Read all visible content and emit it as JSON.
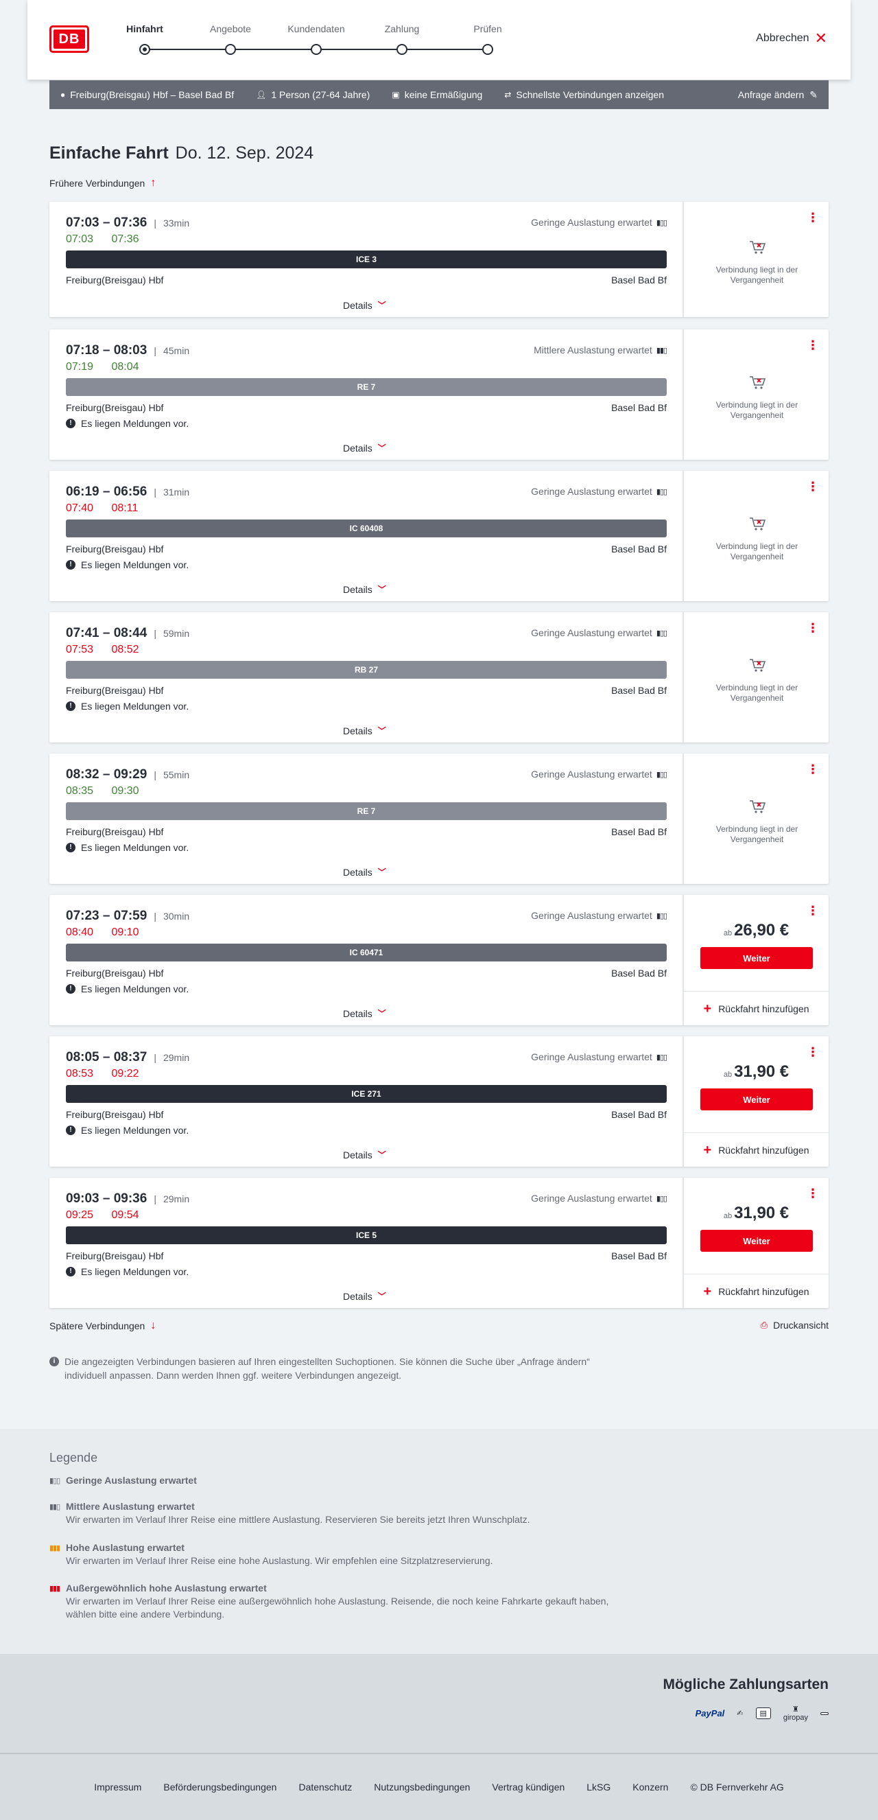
{
  "header": {
    "logo_text": "DB",
    "steps": [
      "Hinfahrt",
      "Angebote",
      "Kundendaten",
      "Zahlung",
      "Prüfen"
    ],
    "cancel_label": "Abbrechen"
  },
  "search": {
    "route": "Freiburg(Breisgau) Hbf – Basel Bad Bf",
    "passengers": "1 Person (27-64 Jahre)",
    "discount": "keine Ermäßigung",
    "fastest": "Schnellste Verbindungen anzeigen",
    "change_label": "Anfrage ändern"
  },
  "page": {
    "title_bold": "Einfache Fahrt",
    "title_date": "Do. 12. Sep. 2024",
    "earlier_label": "Frühere Verbindungen",
    "later_label": "Spätere Verbindungen",
    "print_label": "Druckansicht",
    "info_text": "Die angezeigten Verbindungen basieren auf Ihren eingestellten Suchoptionen. Sie können die Suche über „Anfrage ändern“ individuell anpassen. Dann werden Ihnen ggf. weitere Verbindungen angezeigt."
  },
  "connections": [
    {
      "times": "07:03 – 07:36",
      "duration": "33min",
      "load": "Geringe Auslastung erwartet",
      "rt_dep": "07:03",
      "rt_arr": "07:36",
      "rt_status": "ontime",
      "train": "ICE 3",
      "bar": "dark",
      "from": "Freiburg(Breisgau) Hbf",
      "to": "Basel Bad Bf",
      "note": "",
      "details": "Details",
      "past_text": "Verbindung liegt in der Vergangenheit",
      "price_prefix": "",
      "price": "",
      "button": "",
      "return_label": ""
    },
    {
      "times": "07:18 – 08:03",
      "duration": "45min",
      "load": "Mittlere Auslastung erwartet",
      "rt_dep": "07:19",
      "rt_arr": "08:04",
      "rt_status": "ontime",
      "train": "RE 7",
      "bar": "light",
      "from": "Freiburg(Breisgau) Hbf",
      "to": "Basel Bad Bf",
      "note": "Es liegen Meldungen vor.",
      "details": "Details",
      "past_text": "Verbindung liegt in der Vergangenheit",
      "price_prefix": "",
      "price": "",
      "button": "",
      "return_label": ""
    },
    {
      "times": "06:19 – 06:56",
      "duration": "31min",
      "load": "Geringe Auslastung erwartet",
      "rt_dep": "07:40",
      "rt_arr": "08:11",
      "rt_status": "late",
      "train": "IC 60408",
      "bar": "mid",
      "from": "Freiburg(Breisgau) Hbf",
      "to": "Basel Bad Bf",
      "note": "Es liegen Meldungen vor.",
      "details": "Details",
      "past_text": "Verbindung liegt in der Vergangenheit",
      "price_prefix": "",
      "price": "",
      "button": "",
      "return_label": ""
    },
    {
      "times": "07:41 – 08:44",
      "duration": "59min",
      "load": "Geringe Auslastung erwartet",
      "rt_dep": "07:53",
      "rt_arr": "08:52",
      "rt_status": "late",
      "train": "RB 27",
      "bar": "light",
      "from": "Freiburg(Breisgau) Hbf",
      "to": "Basel Bad Bf",
      "note": "Es liegen Meldungen vor.",
      "details": "Details",
      "past_text": "Verbindung liegt in der Vergangenheit",
      "price_prefix": "",
      "price": "",
      "button": "",
      "return_label": ""
    },
    {
      "times": "08:32 – 09:29",
      "duration": "55min",
      "load": "Geringe Auslastung erwartet",
      "rt_dep": "08:35",
      "rt_arr": "09:30",
      "rt_status": "ontime",
      "train": "RE 7",
      "bar": "light",
      "from": "Freiburg(Breisgau) Hbf",
      "to": "Basel Bad Bf",
      "note": "Es liegen Meldungen vor.",
      "details": "Details",
      "past_text": "Verbindung liegt in der Vergangenheit",
      "price_prefix": "",
      "price": "",
      "button": "",
      "return_label": ""
    },
    {
      "times": "07:23 – 07:59",
      "duration": "30min",
      "load": "Geringe Auslastung erwartet",
      "rt_dep": "08:40",
      "rt_arr": "09:10",
      "rt_status": "late",
      "train": "IC 60471",
      "bar": "mid",
      "from": "Freiburg(Breisgau) Hbf",
      "to": "Basel Bad Bf",
      "note": "Es liegen Meldungen vor.",
      "details": "Details",
      "past_text": "",
      "price_prefix": "ab",
      "price": "26,90 €",
      "button": "Weiter",
      "return_label": "Rückfahrt hinzufügen"
    },
    {
      "times": "08:05 – 08:37",
      "duration": "29min",
      "load": "Geringe Auslastung erwartet",
      "rt_dep": "08:53",
      "rt_arr": "09:22",
      "rt_status": "late",
      "train": "ICE 271",
      "bar": "dark",
      "from": "Freiburg(Breisgau) Hbf",
      "to": "Basel Bad Bf",
      "note": "Es liegen Meldungen vor.",
      "details": "Details",
      "past_text": "",
      "price_prefix": "ab",
      "price": "31,90 €",
      "button": "Weiter",
      "return_label": "Rückfahrt hinzufügen"
    },
    {
      "times": "09:03 – 09:36",
      "duration": "29min",
      "load": "Geringe Auslastung erwartet",
      "rt_dep": "09:25",
      "rt_arr": "09:54",
      "rt_status": "late",
      "train": "ICE 5",
      "bar": "dark",
      "from": "Freiburg(Breisgau) Hbf",
      "to": "Basel Bad Bf",
      "note": "Es liegen Meldungen vor.",
      "details": "Details",
      "past_text": "",
      "price_prefix": "ab",
      "price": "31,90 €",
      "button": "Weiter",
      "return_label": "Rückfahrt hinzufügen"
    }
  ],
  "legend": {
    "title": "Legende",
    "items": [
      {
        "title": "Geringe Auslastung erwartet",
        "text": "",
        "level": "low"
      },
      {
        "title": "Mittlere Auslastung erwartet",
        "text": "Wir erwarten im Verlauf Ihrer Reise eine mittlere Auslastung. Reservieren Sie bereits jetzt Ihren Wunschplatz.",
        "level": "mid"
      },
      {
        "title": "Hohe Auslastung erwartet",
        "text": "Wir erwarten im Verlauf Ihrer Reise eine hohe Auslastung. Wir empfehlen eine Sitzplatzreservierung.",
        "level": "high"
      },
      {
        "title": "Außergewöhnlich hohe Auslastung erwartet",
        "text": "Wir erwarten im Verlauf Ihrer Reise eine außergewöhnlich hohe Auslastung. Reisende, die noch keine Fahrkarte gekauft haben, wählen bitte eine andere Verbindung.",
        "level": "very-high"
      }
    ]
  },
  "payment": {
    "title": "Mögliche Zahlungsarten",
    "methods": [
      "PayPal",
      "giropay",
      "Apple Pay"
    ]
  },
  "footer": {
    "links": [
      "Impressum",
      "Beförderungsbedingungen",
      "Datenschutz",
      "Nutzungsbedingungen",
      "Vertrag kündigen",
      "LkSG",
      "Konzern",
      "© DB Fernverkehr AG"
    ]
  },
  "colors": {
    "brand_red": "#ec0016",
    "ontime_green": "#408335",
    "text_dark": "#282d37",
    "text_grey": "#646973"
  }
}
